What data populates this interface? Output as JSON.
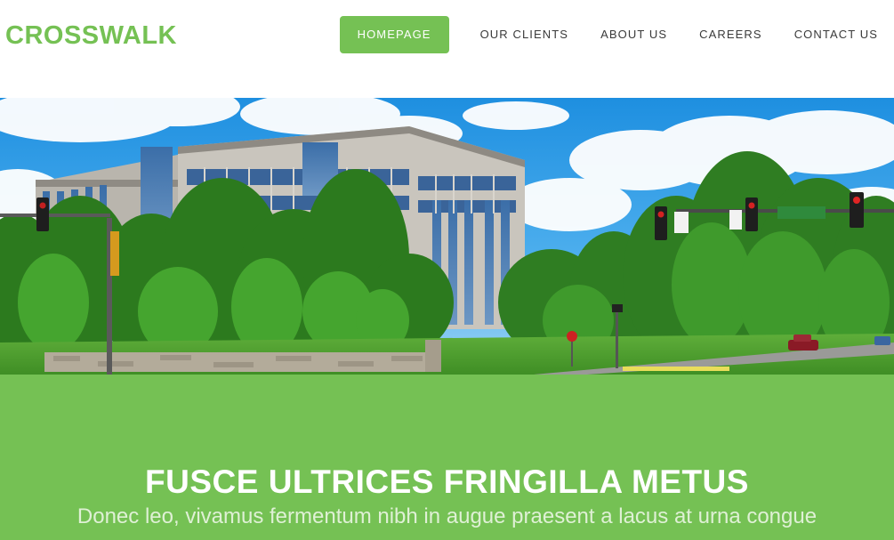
{
  "header": {
    "logo": "CROSSWALK",
    "nav": [
      {
        "label": "HOMEPAGE",
        "active": true
      },
      {
        "label": "OUR CLIENTS",
        "active": false
      },
      {
        "label": "ABOUT US",
        "active": false
      },
      {
        "label": "CAREERS",
        "active": false
      },
      {
        "label": "CONTACT US",
        "active": false
      }
    ]
  },
  "hero": {
    "image": "office-building-photo"
  },
  "banner": {
    "title": "FUSCE ULTRICES FRINGILLA METUS",
    "subtitle": "Donec leo, vivamus fermentum nibh in augue praesent a lacus at urna congue"
  },
  "colors": {
    "accent": "#75c154",
    "nav_text": "#3a3a3a",
    "white": "#ffffff"
  }
}
